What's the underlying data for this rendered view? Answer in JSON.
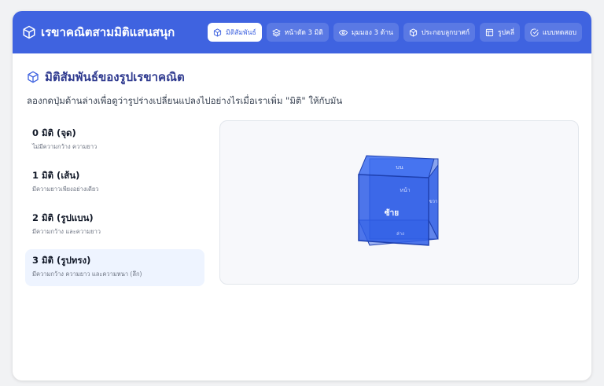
{
  "app": {
    "title": "เรขาคณิตสามมิติแสนสนุก"
  },
  "tabs": [
    {
      "label": "มิติสัมพันธ์",
      "icon": "cube-icon",
      "active": true
    },
    {
      "label": "หน้าตัด 3 มิติ",
      "icon": "layers-icon",
      "active": false
    },
    {
      "label": "มุมมอง 3 ด้าน",
      "icon": "eye-icon",
      "active": false
    },
    {
      "label": "ประกอบลูกบาศก์",
      "icon": "cube-icon",
      "active": false
    },
    {
      "label": "รูปคลี่",
      "icon": "layout-icon",
      "active": false
    },
    {
      "label": "แบบทดสอบ",
      "icon": "check-circle-icon",
      "active": false
    }
  ],
  "section": {
    "title": "มิติสัมพันธ์ของรูปเรขาคณิต",
    "description": "ลองกดปุ่มด้านล่างเพื่อดูว่ารูปร่างเปลี่ยนแปลงไปอย่างไรเมื่อเราเพิ่ม \"มิติ\" ให้กับมัน"
  },
  "dimensions": [
    {
      "title": "0 มิติ (จุด)",
      "subtitle": "ไม่มีความกว้าง ความยาว",
      "active": false
    },
    {
      "title": "1 มิติ (เส้น)",
      "subtitle": "มีความยาวเพียงอย่างเดียว",
      "active": false
    },
    {
      "title": "2 มิติ (รูปแบน)",
      "subtitle": "มีความกว้าง และความยาว",
      "active": false
    },
    {
      "title": "3 มิติ (รูปทรง)",
      "subtitle": "มีความกว้าง ความยาว และความหนา (ลึก)",
      "active": true
    }
  ],
  "viewer": {
    "front_face_label": "ซ้าย",
    "top_face_label": "บน",
    "back_face_label": "หน้า",
    "right_face_label": "ขวา",
    "bottom_face_label": "ล่าง",
    "face_color": "#2f5ee6"
  },
  "colors": {
    "accent": "#3f63e0",
    "active_bg": "#eef4ff"
  }
}
